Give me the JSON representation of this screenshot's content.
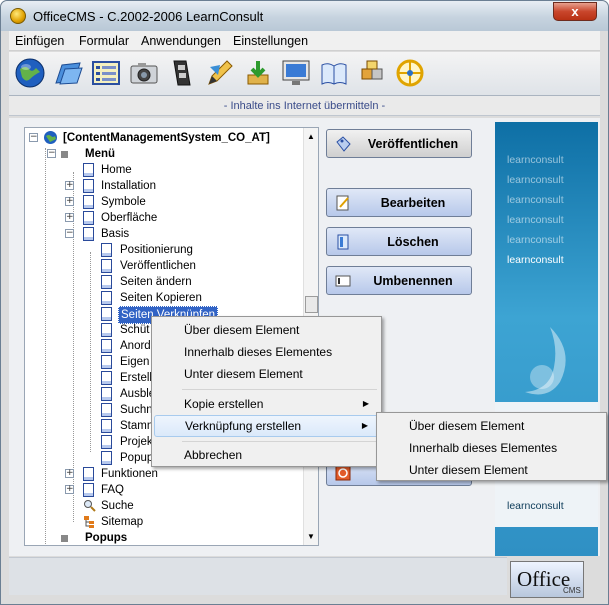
{
  "window": {
    "title": "OfficeCMS - C.2002-2006 LearnConsult",
    "close_label": "x"
  },
  "menubar": [
    "Einfügen",
    "Formular",
    "Anwendungen",
    "Einstellungen"
  ],
  "toolbar_icons": [
    "globe-icon",
    "folder-icon",
    "list-icon",
    "camera-icon",
    "film-icon",
    "pencil-icon",
    "download-icon",
    "monitor-icon",
    "book-icon",
    "puzzle-icon",
    "compass-icon"
  ],
  "status": "- Inhalte ins Internet übermitteln -",
  "tree": {
    "root": "[ContentManagementSystem_CO_AT]",
    "menu": "Menü",
    "items": [
      "Home",
      "Installation",
      "Symbole",
      "Oberfläche",
      "Basis"
    ],
    "basis_children": [
      "Positionierung",
      "Veröffentlichen",
      "Seiten ändern",
      "Seiten Kopieren",
      "Seiten Verknüpfen",
      "Schüt",
      "Anord",
      "Eigen",
      "Erstell",
      "Ausble",
      "Suchn",
      "Stamn",
      "Projek",
      "Popup"
    ],
    "bottom_items": [
      "Funktionen",
      "FAQ",
      "Suche",
      "Sitemap"
    ],
    "popups": "Popups"
  },
  "buttons": {
    "publish": "Veröffentlichen",
    "edit": "Bearbeiten",
    "delete": "Löschen",
    "rename": "Umbenennen"
  },
  "context_menu": {
    "items": [
      "Über diesem Element",
      "Innerhalb dieses Elementes",
      "Unter diesem Element",
      "Kopie erstellen",
      "Verknüpfung erstellen",
      "Abbrechen"
    ]
  },
  "submenu": {
    "items": [
      "Über diesem Element",
      "Innerhalb dieses Elementes",
      "Unter diesem Element"
    ]
  },
  "brand": {
    "logo_text": "learnconsult",
    "office": "Office",
    "cms": "CMS"
  },
  "colors": {
    "accent": "#3163c5",
    "panel": "#2f90c4"
  }
}
